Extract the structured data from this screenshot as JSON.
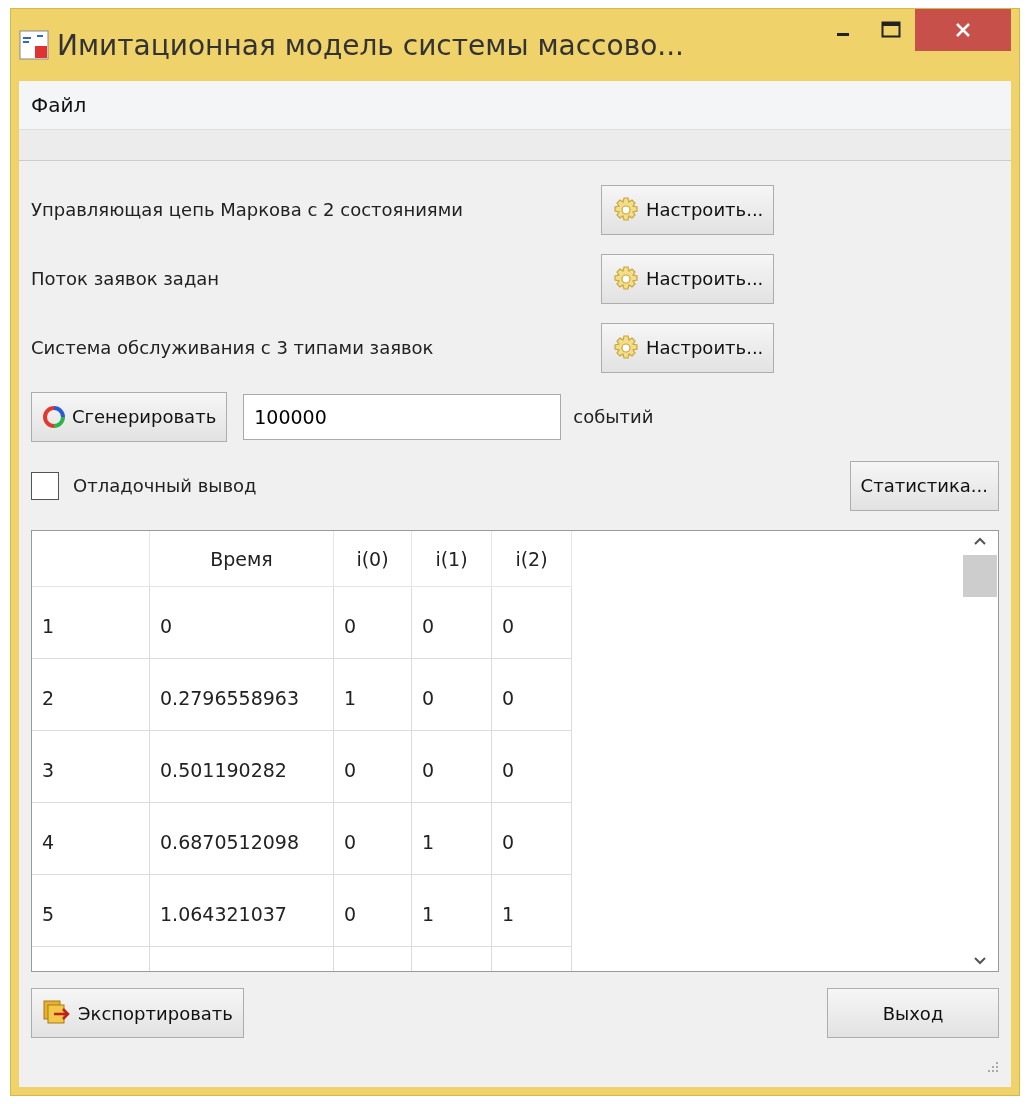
{
  "window": {
    "title": "Имитационная модель системы массово..."
  },
  "menu": [
    "Файл"
  ],
  "config_rows": [
    {
      "label": "Управляющая цепь Маркова с 2 состояниями",
      "button": "Настроить..."
    },
    {
      "label": "Поток заявок задан",
      "button": "Настроить..."
    },
    {
      "label": "Система обслуживания с 3 типами заявок",
      "button": "Настроить..."
    }
  ],
  "generate": {
    "button": "Сгенерировать",
    "value": "100000",
    "unit": "событий"
  },
  "debug": {
    "label": "Отладочный вывод",
    "checked": false
  },
  "stats_button": "Статистика...",
  "table": {
    "columns": [
      "Время",
      "i(0)",
      "i(1)",
      "i(2)"
    ],
    "rows": [
      {
        "header": "1",
        "cells": [
          "0",
          "0",
          "0",
          "0"
        ]
      },
      {
        "header": "2",
        "cells": [
          "0.2796558963",
          "1",
          "0",
          "0"
        ]
      },
      {
        "header": "3",
        "cells": [
          "0.501190282",
          "0",
          "0",
          "0"
        ]
      },
      {
        "header": "4",
        "cells": [
          "0.6870512098",
          "0",
          "1",
          "0"
        ]
      },
      {
        "header": "5",
        "cells": [
          "1.064321037",
          "0",
          "1",
          "1"
        ]
      }
    ]
  },
  "export_button": "Экспортировать",
  "exit_button": "Выход"
}
